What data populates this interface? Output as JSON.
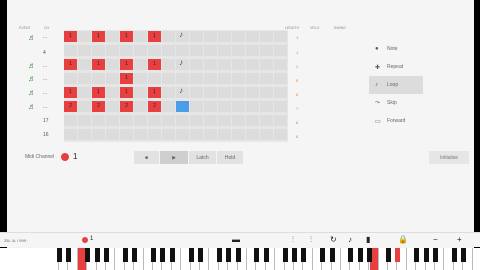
{
  "header": {
    "col_a": "EVENT",
    "col_b": "CH",
    "col_c": "LENGTH",
    "col_d": "VELO",
    "col_e": "SWING"
  },
  "rows": [
    {
      "label": "...",
      "icon": "note-icon",
      "cells": [
        1,
        0,
        1,
        0,
        1,
        0,
        1,
        0,
        0,
        0,
        0,
        0,
        0,
        0,
        0,
        0
      ],
      "num": "1"
    },
    {
      "label": "4",
      "icon": "",
      "cells": [
        0,
        0,
        0,
        0,
        0,
        0,
        0,
        0,
        0,
        0,
        0,
        0,
        0,
        0,
        0,
        0
      ],
      "num": "1"
    },
    {
      "label": "...",
      "icon": "note-icon",
      "cells": [
        1,
        0,
        1,
        0,
        1,
        0,
        1,
        0,
        0,
        0,
        0,
        0,
        0,
        0,
        0,
        0
      ],
      "num": "2"
    },
    {
      "label": "...",
      "icon": "note-icon",
      "cells": [
        0,
        0,
        0,
        0,
        1,
        0,
        0,
        0,
        0,
        0,
        0,
        0,
        0,
        0,
        0,
        0
      ],
      "num": "5"
    },
    {
      "label": "...",
      "icon": "note-icon",
      "cells": [
        1,
        0,
        1,
        0,
        1,
        0,
        1,
        0,
        0,
        0,
        0,
        0,
        0,
        0,
        0,
        0
      ],
      "num": "6"
    },
    {
      "label": "...",
      "icon": "note-icon",
      "cells": [
        1,
        0,
        1,
        0,
        1,
        0,
        1,
        0,
        0,
        0,
        0,
        0,
        0,
        0,
        0,
        0
      ],
      "num": "7"
    },
    {
      "label": "17",
      "icon": "",
      "cells": [
        0,
        0,
        0,
        0,
        0,
        0,
        0,
        0,
        0,
        0,
        0,
        0,
        0,
        0,
        0,
        0
      ],
      "num": "8"
    },
    {
      "label": "16",
      "icon": "",
      "cells": [
        0,
        0,
        0,
        0,
        0,
        0,
        0,
        0,
        0,
        0,
        0,
        0,
        0,
        0,
        0,
        0
      ],
      "num": "8"
    }
  ],
  "cell_marks": [
    "1",
    "1",
    "1",
    "1",
    "1",
    "1",
    "1",
    "1",
    "1",
    "1",
    "1",
    "1",
    "1",
    "2",
    "2",
    "2",
    "2"
  ],
  "panel": {
    "items": [
      {
        "label": "Note",
        "icon": "circle-icon",
        "active": false
      },
      {
        "label": "Repeat",
        "icon": "plus-icon",
        "active": false
      },
      {
        "label": "Loop",
        "icon": "note-icon",
        "active": true
      },
      {
        "label": "Skip",
        "icon": "skip-icon",
        "active": false
      },
      {
        "label": "Forward",
        "icon": "forward-icon",
        "active": false
      }
    ]
  },
  "footer": {
    "label": "Midi Channel",
    "channel": "1"
  },
  "transport": {
    "latch": "Latch",
    "hold": "Hold"
  },
  "initialise": "Initialise",
  "kbar": {
    "position": "25L 4L / 999 ·",
    "channel": "1"
  },
  "colors": {
    "accent": "#e84040",
    "selected": "#4a9ee8"
  }
}
